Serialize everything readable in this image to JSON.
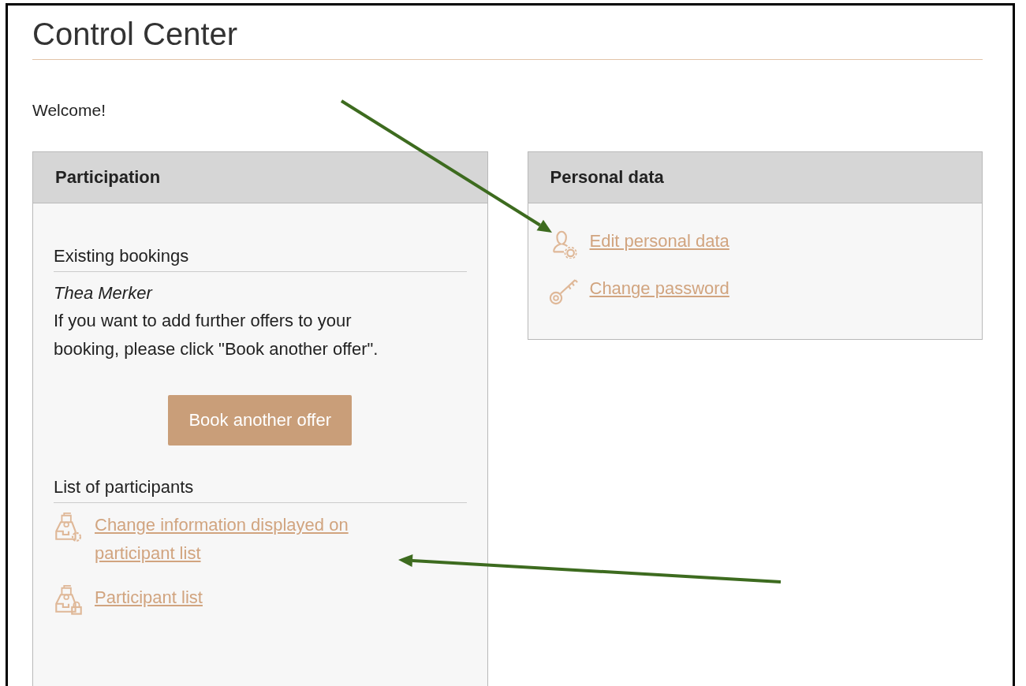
{
  "page": {
    "title": "Control Center",
    "welcome": "Welcome!"
  },
  "panels": [
    {
      "title": "Participation",
      "sections": [
        {
          "heading": "Existing bookings",
          "name": "Thea Merker",
          "text": "If you want to add further offers to your booking, please click \"Book another offer\".",
          "button": "Book another offer"
        },
        {
          "heading": "List of participants",
          "links": [
            {
              "label": "Change information displayed on participant list",
              "kind": "list-gear"
            },
            {
              "label": "Participant list",
              "kind": "list-lock"
            }
          ]
        }
      ]
    },
    {
      "title": "Personal data",
      "links": [
        {
          "label": "Edit personal data",
          "kind": "user-gear"
        },
        {
          "label": "Change password",
          "kind": "key"
        }
      ]
    }
  ],
  "annotations": [
    {
      "kind": "arrow"
    },
    {
      "kind": "arrow"
    }
  ]
}
